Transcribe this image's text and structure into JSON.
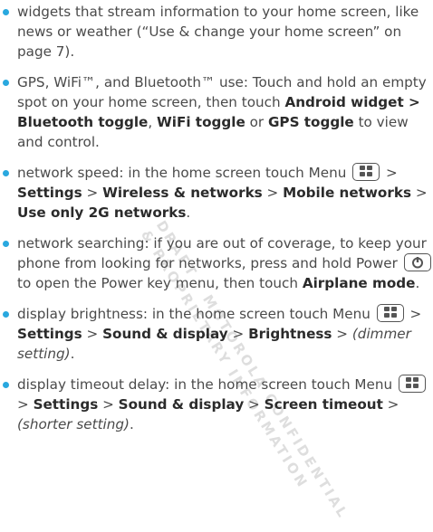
{
  "watermark": {
    "line1": "DRAFT - MOTOROLA CONFIDENTIAL",
    "line2": "& PROPRIETARY INFORMATION"
  },
  "tips": [
    {
      "text": "widgets that stream information to your home screen, like news or weather (“Use & change your home screen” on page 7)."
    },
    {
      "a": "GPS, WiFi™, and Bluetooth™ use: Touch and hold an empty spot on your home screen, then touch ",
      "b": "Android widget > Bluetooth toggle",
      "c": ", ",
      "d": "WiFi toggle",
      "e": " or ",
      "f": "GPS toggle",
      "g": " to view and control."
    },
    {
      "a": "network speed: in the home screen touch Menu",
      "b": " > ",
      "c": "Settings",
      "d": " > ",
      "e": "Wireless & networks",
      "f": " > ",
      "g": "Mobile networks",
      "h": " > ",
      "i": "Use only 2G networks",
      "j": "."
    },
    {
      "a": "network searching: if you are out of coverage, to keep your phone from looking for networks, press and hold Power",
      "b": " to open the Power key menu, then touch ",
      "c": "Airplane mode",
      "d": "."
    },
    {
      "a": "display brightness: in the home screen touch Menu",
      "b": " > ",
      "c": "Settings",
      "d": " > ",
      "e": "Sound & display",
      "f": " > ",
      "g": "Brightness",
      "h": " > ",
      "i": "(dimmer setting)",
      "j": "."
    },
    {
      "a": "display timeout delay: in the home screen touch Menu",
      "b": " > ",
      "c": "Settings",
      "d": " > ",
      "e": "Sound & display",
      "f": " > ",
      "g": "Screen timeout",
      "h": " > ",
      "i": "(shorter setting)",
      "j": "."
    }
  ],
  "icons": {
    "menu_key": "menu-key-icon",
    "power_key": "power-key-icon"
  },
  "colors": {
    "bullet": "#29a8df",
    "text": "#4a4a4a",
    "bold": "#2b2b2b"
  }
}
